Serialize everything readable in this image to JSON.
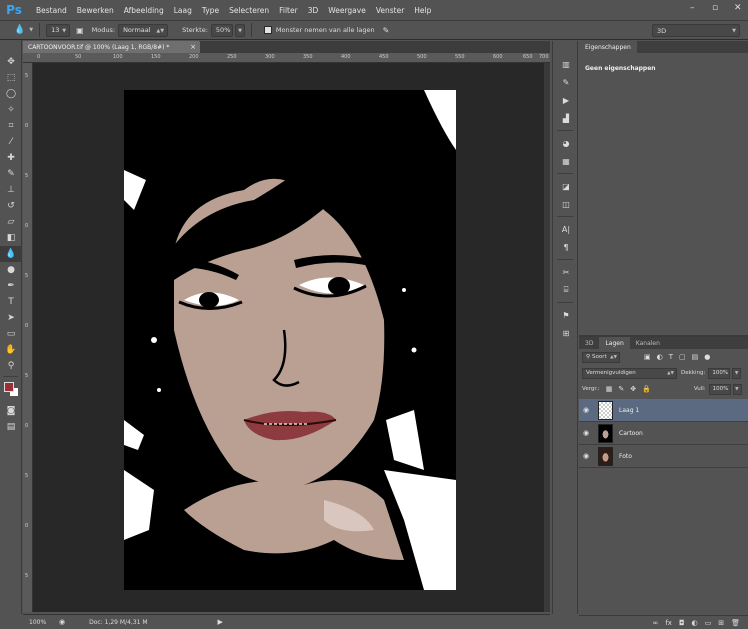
{
  "app": {
    "logo": "Ps"
  },
  "menu": [
    "Bestand",
    "Bewerken",
    "Afbeelding",
    "Laag",
    "Type",
    "Selecteren",
    "Filter",
    "3D",
    "Weergave",
    "Venster",
    "Help"
  ],
  "window_controls": [
    "minimize-icon",
    "maximize-icon",
    "close-icon"
  ],
  "options": {
    "brush_size": "13",
    "mode_label": "Modus:",
    "mode_value": "Normaal",
    "strength_label": "Sterkte:",
    "strength_value": "50%",
    "sample_all_label": "Monster nemen van alle lagen",
    "workspace": "3D"
  },
  "document": {
    "tab_title": "CARTOONVOOR.tif @ 100% (Laag 1, RGB/8#) *",
    "close": "×",
    "zoom": "100%",
    "doc_info": "Doc: 1,29 M/4,31 M",
    "ruler_h": [
      "0",
      "50",
      "100",
      "150",
      "200",
      "250",
      "300",
      "350",
      "400",
      "450",
      "500",
      "550",
      "600",
      "650",
      "700"
    ],
    "ruler_v": [
      "5",
      "0",
      "5",
      "0",
      "5",
      "0",
      "5",
      "0",
      "5",
      "0",
      "5"
    ]
  },
  "properties": {
    "tab": "Eigenschappen",
    "empty_text": "Geen eigenschappen"
  },
  "layers_panel": {
    "tabs": [
      "3D",
      "Lagen",
      "Kanalen"
    ],
    "filter": "Soort",
    "blend_mode": "Vermenigvuldigen",
    "opacity_label": "Dekking:",
    "opacity_value": "100%",
    "lock_label": "Vergr.:",
    "fill_label": "Vull:",
    "fill_value": "100%",
    "layers": [
      {
        "name": "Laag 1",
        "selected": true,
        "thumb": "transparent"
      },
      {
        "name": "Cartoon",
        "selected": false,
        "thumb": "cartoon"
      },
      {
        "name": "Foto",
        "selected": false,
        "thumb": "photo"
      }
    ]
  },
  "colors": {
    "foreground": "#9a2f35",
    "background": "#ffffff",
    "selection": "#5b6a80"
  }
}
